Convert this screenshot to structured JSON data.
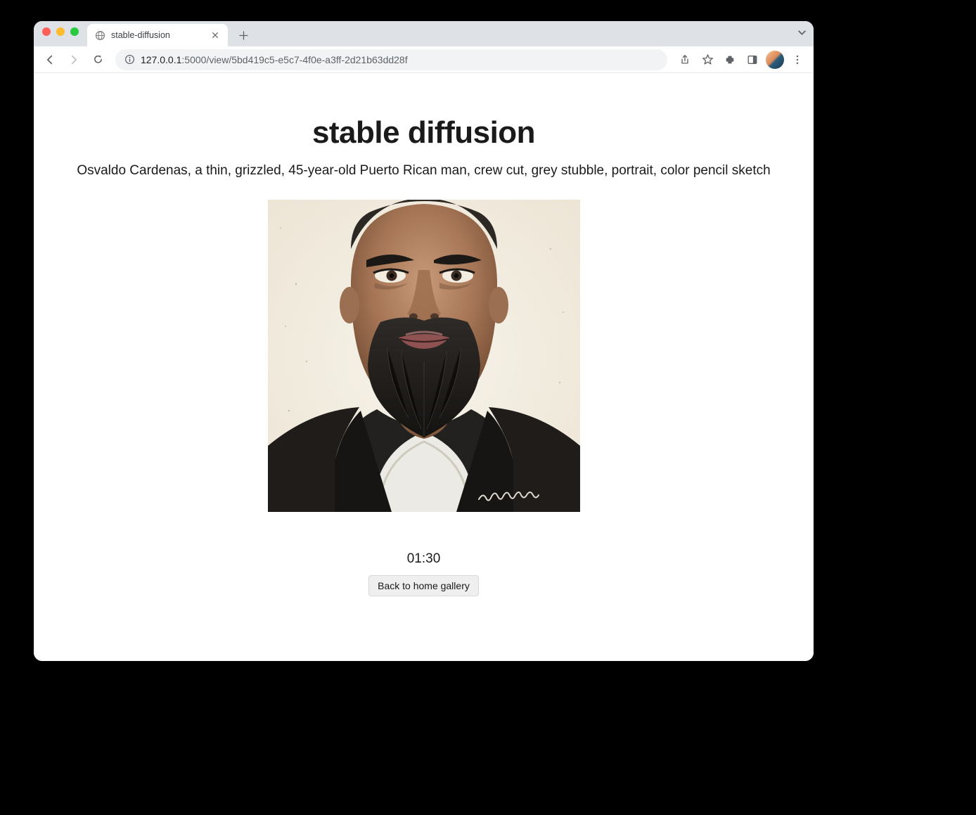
{
  "browser": {
    "tab_title": "stable-diffusion",
    "url_host": "127.0.0.1",
    "url_port_path": ":5000/view/5bd419c5-e5c7-4f0e-a3ff-2d21b63dd28f"
  },
  "page": {
    "title": "stable diffusion",
    "prompt": "Osvaldo Cardenas, a thin, grizzled, 45-year-old Puerto Rican man, crew cut, grey stubble, portrait, color pencil sketch",
    "elapsed": "01:30",
    "back_label": "Back to home gallery",
    "image_alt": "Generated portrait: color pencil sketch of a middle-aged man with crew cut, dark beard and mustache, wearing dark top over white undershirt"
  }
}
